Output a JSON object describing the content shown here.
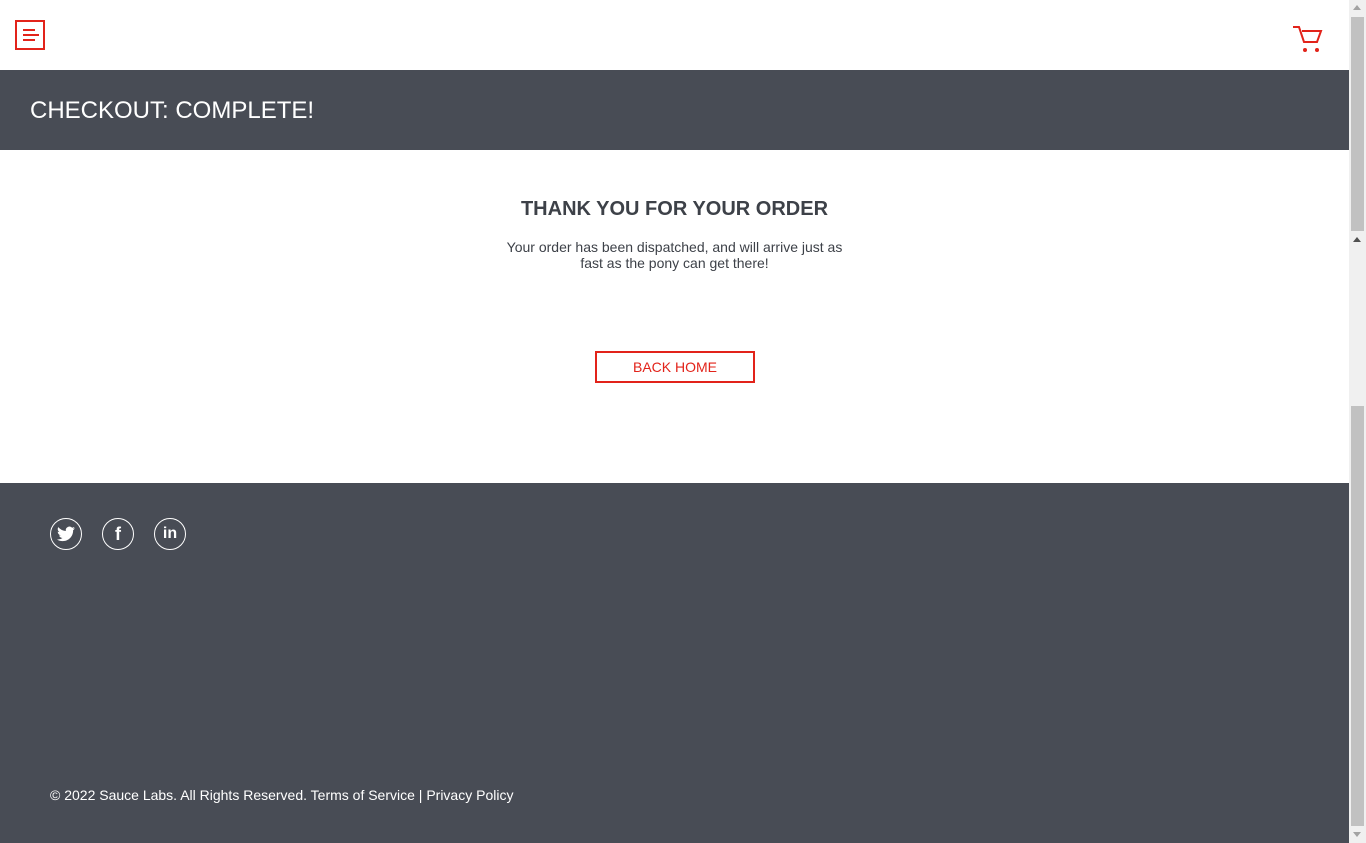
{
  "header": {
    "menu_icon": "hamburger-menu-icon",
    "cart_icon": "shopping-cart-icon"
  },
  "page_title": "CHECKOUT: COMPLETE!",
  "main": {
    "heading": "THANK YOU FOR YOUR ORDER",
    "message": "Your order has been dispatched, and will arrive just as fast as the pony can get there!",
    "back_button": "BACK HOME"
  },
  "footer": {
    "social": [
      {
        "name": "twitter-icon",
        "glyph": "🐦"
      },
      {
        "name": "facebook-icon",
        "glyph": "f"
      },
      {
        "name": "linkedin-icon",
        "glyph": "in"
      }
    ],
    "copyright": "© 2022 Sauce Labs. All Rights Reserved. Terms of Service | Privacy Policy"
  },
  "colors": {
    "accent": "#e2231a",
    "dark": "#484c55"
  }
}
